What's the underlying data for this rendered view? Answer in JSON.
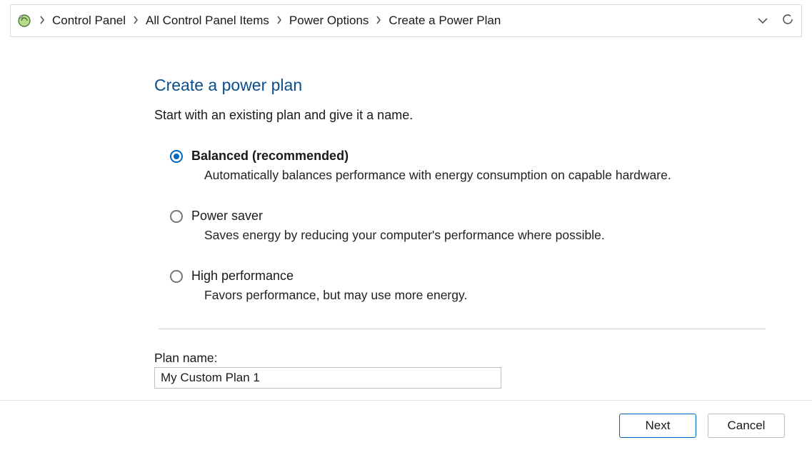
{
  "breadcrumb": {
    "items": [
      "Control Panel",
      "All Control Panel Items",
      "Power Options",
      "Create a Power Plan"
    ]
  },
  "page": {
    "title": "Create a power plan",
    "subtitle": "Start with an existing plan and give it a name."
  },
  "plans": [
    {
      "label": "Balanced (recommended)",
      "desc": "Automatically balances performance with energy consumption on capable hardware.",
      "selected": true
    },
    {
      "label": "Power saver",
      "desc": "Saves energy by reducing your computer's performance where possible.",
      "selected": false
    },
    {
      "label": "High performance",
      "desc": "Favors performance, but may use more energy.",
      "selected": false
    }
  ],
  "plan_name": {
    "label": "Plan name:",
    "value": "My Custom Plan 1"
  },
  "footer": {
    "next": "Next",
    "cancel": "Cancel"
  }
}
